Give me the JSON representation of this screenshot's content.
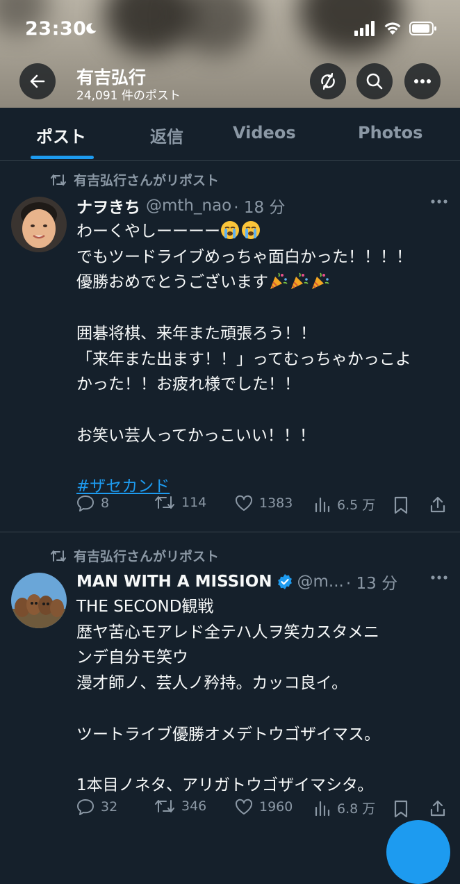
{
  "status_bar": {
    "time": "23:30"
  },
  "header": {
    "profile_name": "有吉弘行",
    "post_count": "24,091 件のポスト"
  },
  "tabs": [
    {
      "label": "ポスト",
      "active": true
    },
    {
      "label": "返信",
      "active": false
    },
    {
      "label": "Videos",
      "active": false
    },
    {
      "label": "Photos",
      "active": false
    }
  ],
  "posts": [
    {
      "repost_label": "有吉弘行さんがリポスト",
      "author": "ナヲきち",
      "handle": "@mth_nao",
      "time": "· 18 分",
      "lines": [
        "わーくやしーーーー",
        "でもツードライブめっちゃ面白かった！！！！",
        "優勝おめでとうございます",
        "",
        "囲碁将棋、来年また頑張ろう！！",
        "「来年また出ます！！」ってむっちゃかっこよ",
        "かった！！お疲れ様でした！！",
        "",
        "お笑い芸人ってかっこいい！！！",
        ""
      ],
      "hashtag": "#ザセカンド",
      "replies": "8",
      "reposts": "114",
      "likes": "1383",
      "views": "6.5 万"
    },
    {
      "repost_label": "有吉弘行さんがリポスト",
      "author": "MAN WITH A MISSION",
      "handle": "@m...",
      "time": "· 13 分",
      "lines": [
        "THE SECOND観戦",
        "歴ヤ苦心モアレド全テハ人ヲ笑カスタメニ",
        "ンデ自分モ笑ウ",
        "漫才師ノ、芸人ノ矜持。カッコ良イ。",
        "",
        "ツートライブ優勝オメデトウゴザイマス。",
        "",
        "1本目ノネタ、アリガトウゴザイマシタ。"
      ],
      "replies": "32",
      "reposts": "346",
      "likes": "1960",
      "views": "6.8 万"
    }
  ],
  "colors": {
    "background": "#15202b",
    "accent": "#1d9bf0",
    "secondary_text": "#8b98a5",
    "divider": "#38444d"
  }
}
